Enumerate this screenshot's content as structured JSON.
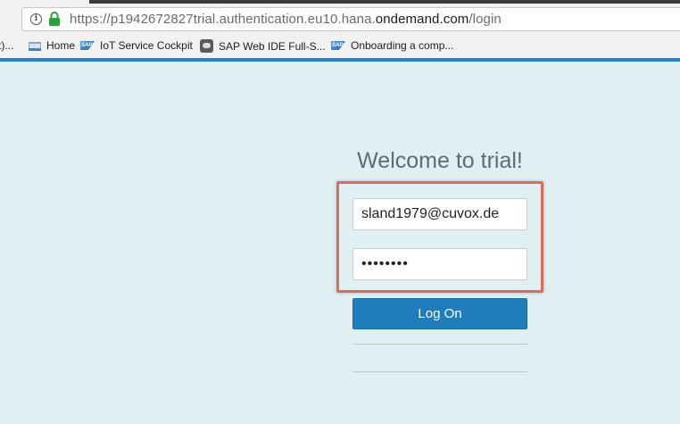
{
  "browser": {
    "url_protocol": "https://",
    "url_host_prefix": "p1942672827trial.authentication.eu10.hana.",
    "url_domain": "ondemand.com",
    "url_path": "/login",
    "bookmarks": [
      {
        "label": "t)...",
        "icon": "none"
      },
      {
        "label": "Home",
        "icon": "home-icon"
      },
      {
        "label": "IoT Service Cockpit",
        "icon": "sap-icon"
      },
      {
        "label": "SAP Web IDE Full-S...",
        "icon": "cloud-icon"
      },
      {
        "label": "Onboarding a comp...",
        "icon": "sap-icon"
      }
    ],
    "accent_color": "#1f85c9",
    "lock_color": "#2aa13a"
  },
  "login": {
    "welcome_text": "Welcome to trial!",
    "email_value": "sland1979@cuvox.de",
    "password_value": "••••••••",
    "logon_label": "Log On",
    "highlight_color": "#e06a5a",
    "button_color": "#1f7dbe",
    "background_color": "#dfeff2"
  }
}
